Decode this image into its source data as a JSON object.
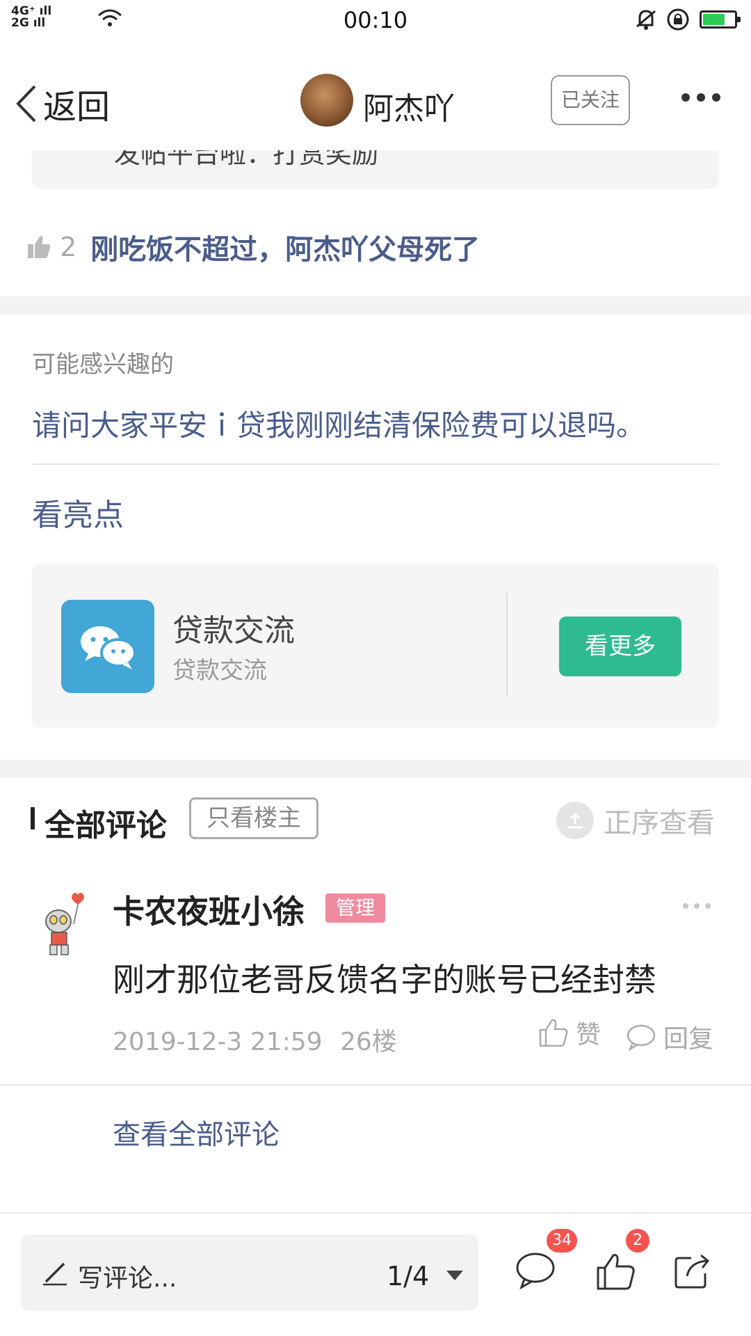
{
  "status_bar": {
    "network_line1": "4G⁺ ıll",
    "network_line2": "2G ıll",
    "time": "00:10",
    "icons": [
      "signal-icon",
      "wifi-icon",
      "mute-icon",
      "rotation-lock-icon",
      "battery-charging-icon"
    ]
  },
  "nav": {
    "back_label": "返回",
    "username": "阿杰吖",
    "follow_label": "已关注"
  },
  "post": {
    "clipped_text": "发帖平台啦：打赏奖励",
    "like_count": "2",
    "highlight_reply": "刚吃饭不超过，阿杰吖父母死了"
  },
  "interest": {
    "title": "可能感兴趣的",
    "link": "请问大家平安ｉ贷我刚刚结清保险费可以退吗。"
  },
  "highlights": {
    "title": "看亮点",
    "group_name": "贷款交流",
    "group_subtitle": "贷款交流",
    "see_more_label": "看更多"
  },
  "comments": {
    "section_title": "全部评论",
    "op_only_label": "只看楼主",
    "sort_label": "正序查看",
    "items": [
      {
        "user": "卡农夜班小徐",
        "badge": "管理",
        "body": "刚才那位老哥反馈名字的账号已经封禁",
        "time": "2019-12-3 21:59",
        "floor": "26楼",
        "like_label": "赞",
        "reply_label": "回复"
      }
    ],
    "view_all_label": "查看全部评论"
  },
  "bottom_bar": {
    "write_placeholder": "写评论...",
    "page_indicator": "1/4",
    "comment_badge": "34",
    "like_badge": "2"
  },
  "colors": {
    "link_blue": "#4a5c8a",
    "accent_green": "#2ebb8f",
    "badge_red": "#f4534f",
    "admin_pink": "#f08a9e",
    "group_icon_blue": "#42a6d6"
  }
}
